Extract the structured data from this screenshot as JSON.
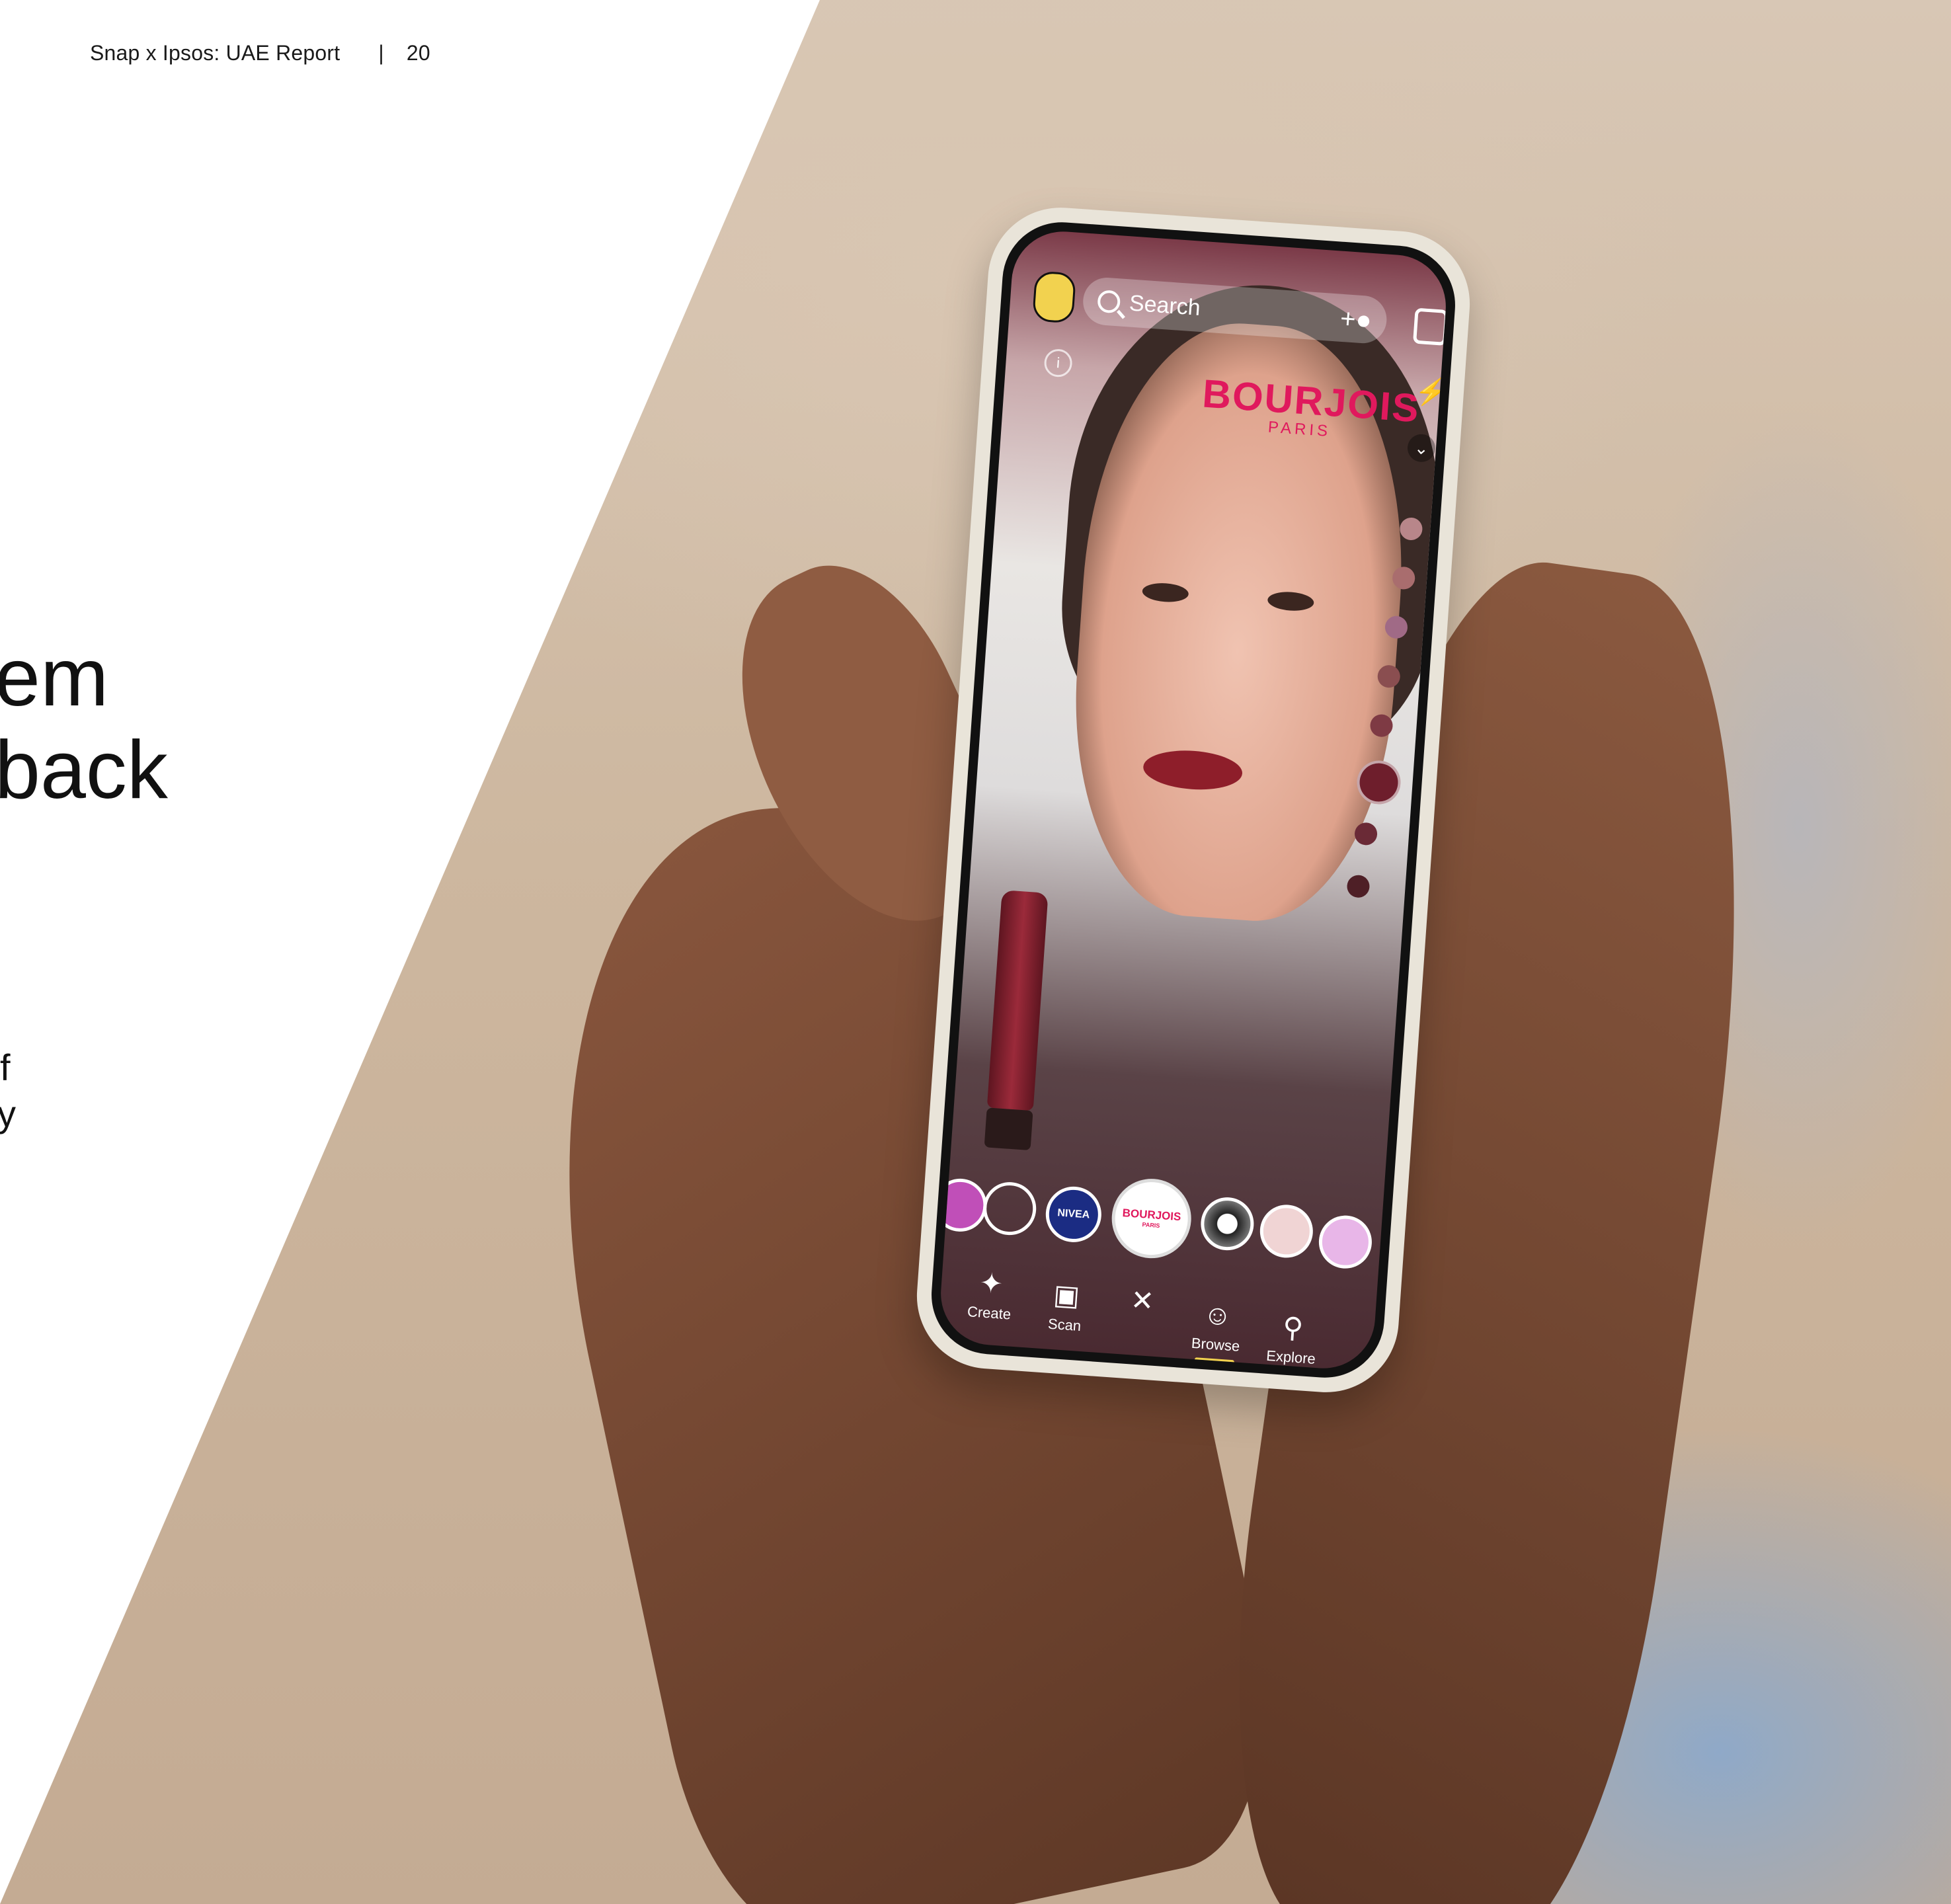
{
  "header": {
    "report_title": "Snap x Ipsos: UAE Report",
    "separator": "|",
    "page_number": "20"
  },
  "headline_fragments": [
    "em",
    "back"
  ],
  "body_fragments": [
    "f",
    "y"
  ],
  "phone_ui": {
    "search_placeholder": "Search",
    "brand_name": "BOURJOIS",
    "brand_sub": "PARIS",
    "lens_labels": {
      "nivea": "NIVEA",
      "bourjois": "BOURJOIS",
      "bourjois_sub": "PARIS"
    },
    "nav": {
      "create": "Create",
      "scan": "Scan",
      "browse": "Browse",
      "explore": "Explore"
    },
    "icons": {
      "search": "search-icon",
      "add_friend": "add-friend-icon",
      "flip_camera": "flip-camera-icon",
      "flash": "flash-icon",
      "chevron": "chevron-down-icon",
      "info": "info-icon"
    },
    "colors": {
      "brand_pink": "#e0195d",
      "nav_underline": "#f2d24f"
    }
  }
}
